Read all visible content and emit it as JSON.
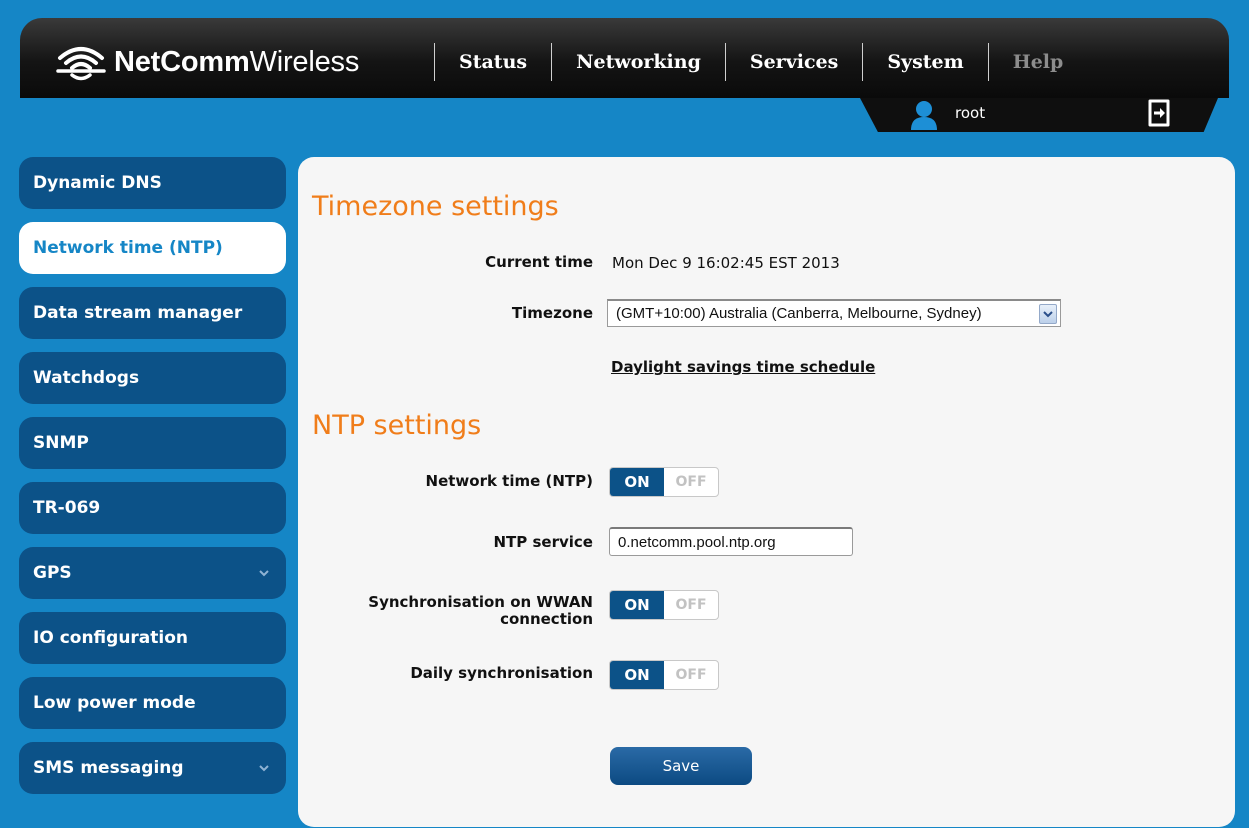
{
  "brand": {
    "name_bold": "NetComm",
    "name_light": "Wireless"
  },
  "nav": {
    "items": [
      {
        "label": "Status"
      },
      {
        "label": "Networking"
      },
      {
        "label": "Services"
      },
      {
        "label": "System"
      },
      {
        "label": "Help"
      }
    ]
  },
  "user": {
    "name": "root"
  },
  "sidebar": {
    "items": [
      {
        "label": "Dynamic DNS"
      },
      {
        "label": "Network time (NTP)",
        "active": true
      },
      {
        "label": "Data stream manager"
      },
      {
        "label": "Watchdogs"
      },
      {
        "label": "SNMP"
      },
      {
        "label": "TR-069"
      },
      {
        "label": "GPS",
        "has_submenu": true
      },
      {
        "label": "IO configuration"
      },
      {
        "label": "Low power mode"
      },
      {
        "label": "SMS messaging",
        "has_submenu": true
      }
    ]
  },
  "timezone": {
    "title": "Timezone settings",
    "current_time_label": "Current time",
    "current_time_value": "Mon Dec 9 16:02:45 EST 2013",
    "timezone_label": "Timezone",
    "timezone_value": "(GMT+10:00) Australia (Canberra, Melbourne, Sydney)",
    "dst_link": "Daylight savings time schedule"
  },
  "ntp": {
    "title": "NTP settings",
    "network_time_label": "Network time (NTP)",
    "ntp_service_label": "NTP service",
    "ntp_service_value": "0.netcomm.pool.ntp.org",
    "sync_wwan_label_line1": "Synchronisation on WWAN",
    "sync_wwan_label_line2": "connection",
    "daily_sync_label": "Daily synchronisation",
    "toggle_on": "ON",
    "toggle_off": "OFF"
  },
  "actions": {
    "save_label": "Save"
  },
  "colors": {
    "page_bg": "#1586c6",
    "sidebar_item": "#0c5288",
    "accent_orange": "#f07d1a",
    "header_black": "#141414"
  }
}
